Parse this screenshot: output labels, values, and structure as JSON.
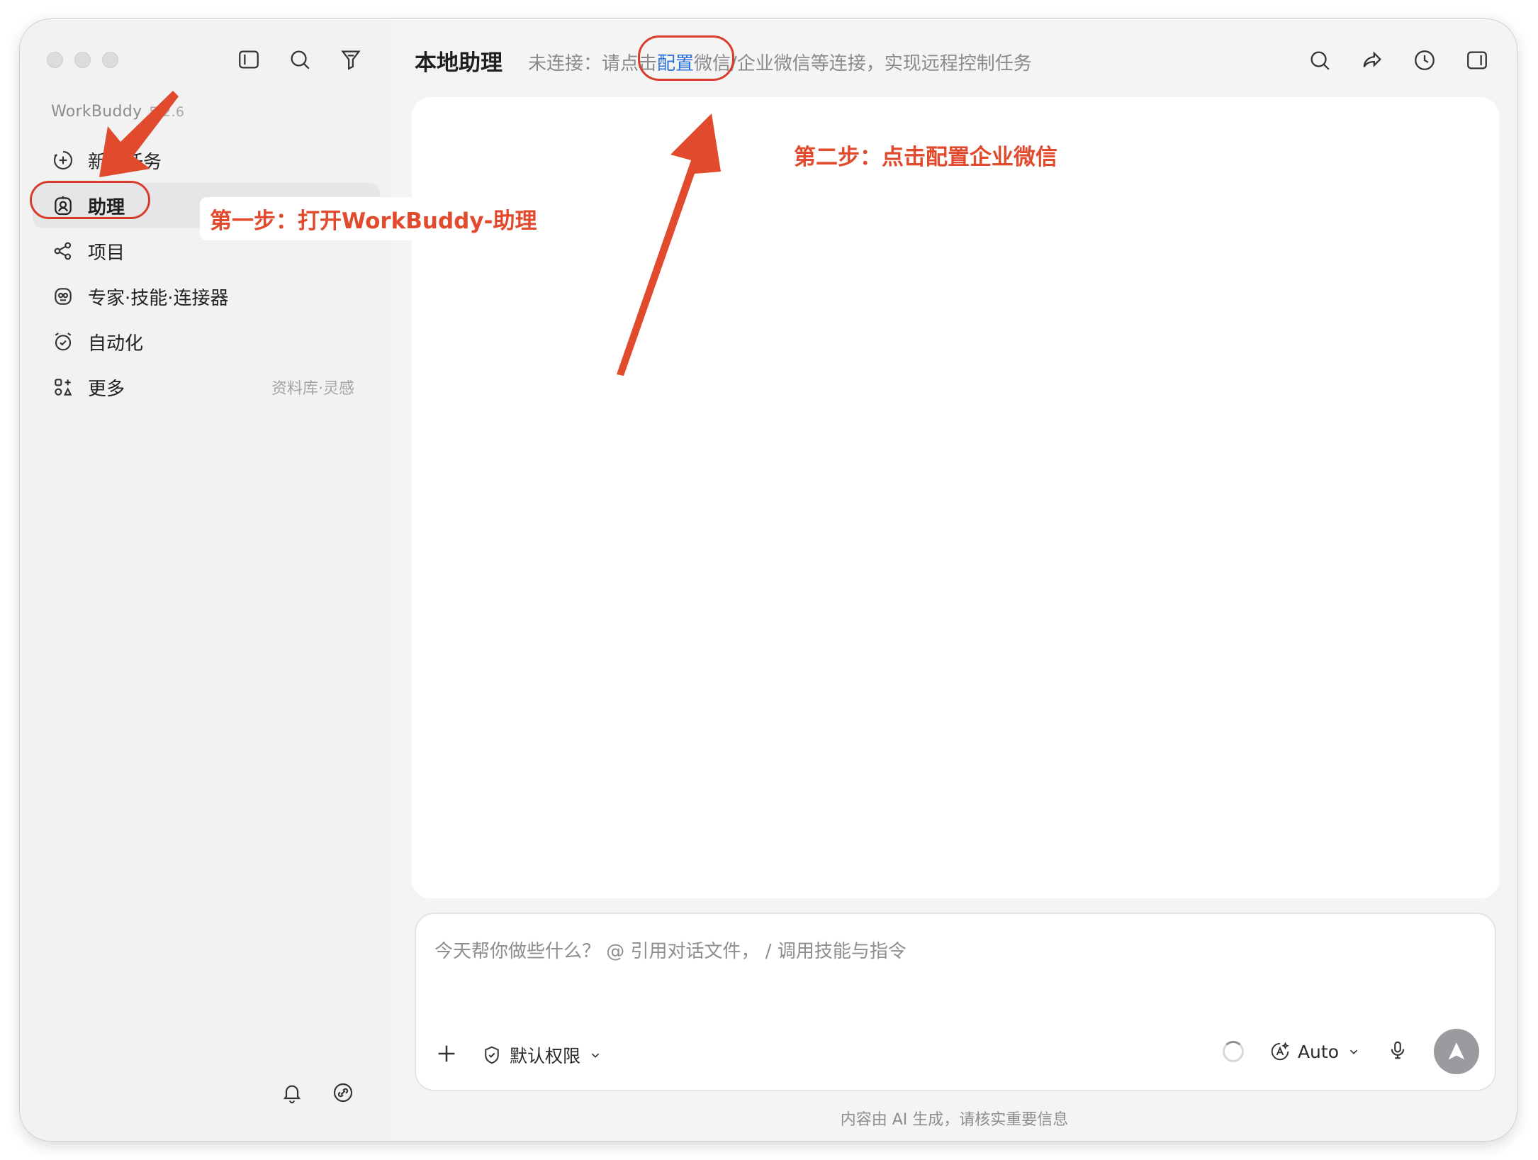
{
  "app": {
    "name": "WorkBuddy",
    "version": "5.2.6"
  },
  "sidebar": {
    "items": [
      {
        "label": "新建任务",
        "icon": "plus-circle-icon",
        "hint": ""
      },
      {
        "label": "助理",
        "icon": "assistant-icon",
        "hint": ""
      },
      {
        "label": "项目",
        "icon": "project-icon",
        "hint": ""
      },
      {
        "label": "专家·技能·连接器",
        "icon": "expert-icon",
        "hint": ""
      },
      {
        "label": "自动化",
        "icon": "alarm-clock-icon",
        "hint": ""
      },
      {
        "label": "更多",
        "icon": "apps-grid-icon",
        "hint": "资料库·灵感"
      }
    ]
  },
  "header": {
    "title": "本地助理",
    "status_prefix": "未连接：请点击",
    "status_link": "配置",
    "status_suffix": "微信/企业微信等连接，实现远程控制任务"
  },
  "composer": {
    "placeholder": "今天帮你做些什么？ @ 引用对话文件， / 调用技能与指令",
    "permission_label": "默认权限",
    "model_label": "Auto"
  },
  "disclaimer": "内容由 AI 生成，请核实重要信息",
  "annotations": {
    "step1": "第一步：打开WorkBuddy-助理",
    "step2": "第二步：点击配置企业微信"
  },
  "colors": {
    "annotation_red": "#e14a2d",
    "link_blue": "#2b72d6"
  }
}
